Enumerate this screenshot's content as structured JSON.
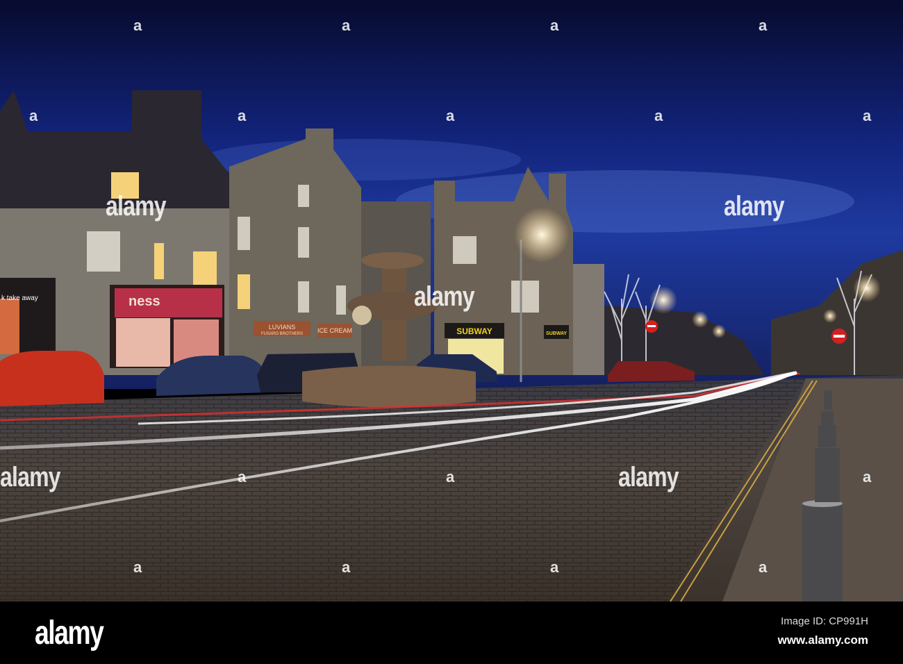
{
  "photo": {
    "signs": {
      "take_away": "k take away",
      "ness": "ness",
      "luvians": "LUVIANS",
      "fusaro": "FUSARO BROTHERS",
      "ice_cream": "ICE CREAM",
      "subway_main": "SUBWAY",
      "subway_side": "SUBWAY"
    },
    "colors": {
      "sky_top": "#0a0f3a",
      "sky_mid": "#1a2f8a",
      "cobble": "#4a3f38"
    }
  },
  "watermark": {
    "text": "alamy",
    "letter": "a"
  },
  "footer": {
    "logo": "alamy",
    "image_id": "Image ID: CP991H",
    "url": "www.alamy.com"
  }
}
